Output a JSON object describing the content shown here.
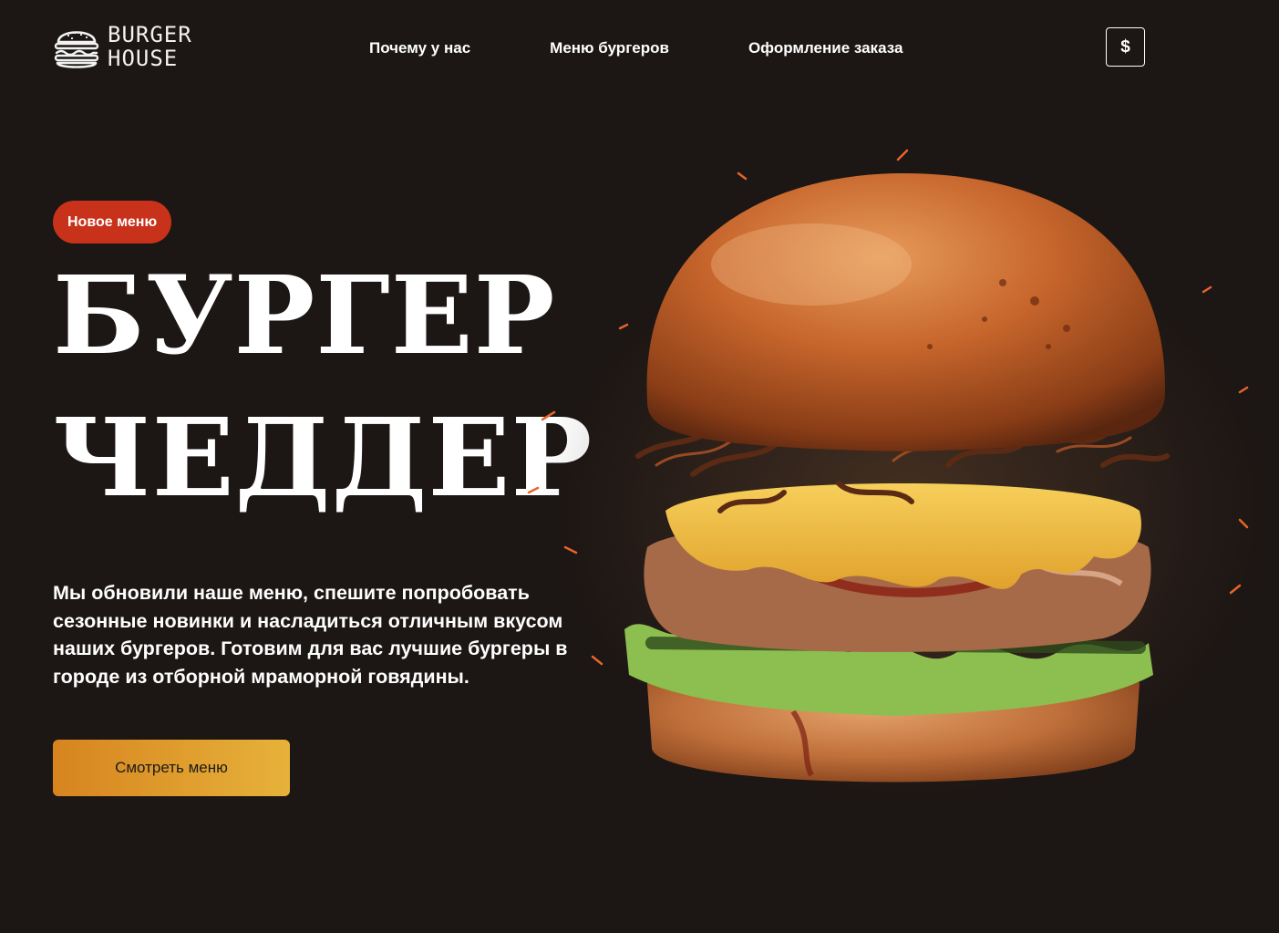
{
  "brand": {
    "line1": "BURGER",
    "line2": "HOUSE",
    "icon": "burger-icon"
  },
  "nav": {
    "items": [
      {
        "label": "Почему у нас"
      },
      {
        "label": "Меню бургеров"
      },
      {
        "label": "Оформление заказа"
      }
    ]
  },
  "currency": {
    "label": "$",
    "icon": "dollar-icon"
  },
  "hero": {
    "badge": "Новое меню",
    "title_line1": "БУРГЕР",
    "title_line2": "ЧЕДДЕР",
    "description": "Мы обновили наше меню, спешите попробовать сезонные новинки и насладиться отличным вкусом наших бургеров. Готовим для вас лучшие бургеры в городе из отборной мраморной говядины.",
    "cta_label": "Смотреть меню",
    "image": "cheddar-burger-image"
  },
  "colors": {
    "background": "#1c1614",
    "badge": "#c8321a",
    "cta_gradient_start": "#d7841f",
    "cta_gradient_end": "#e6b23a",
    "text": "#ffffff"
  }
}
